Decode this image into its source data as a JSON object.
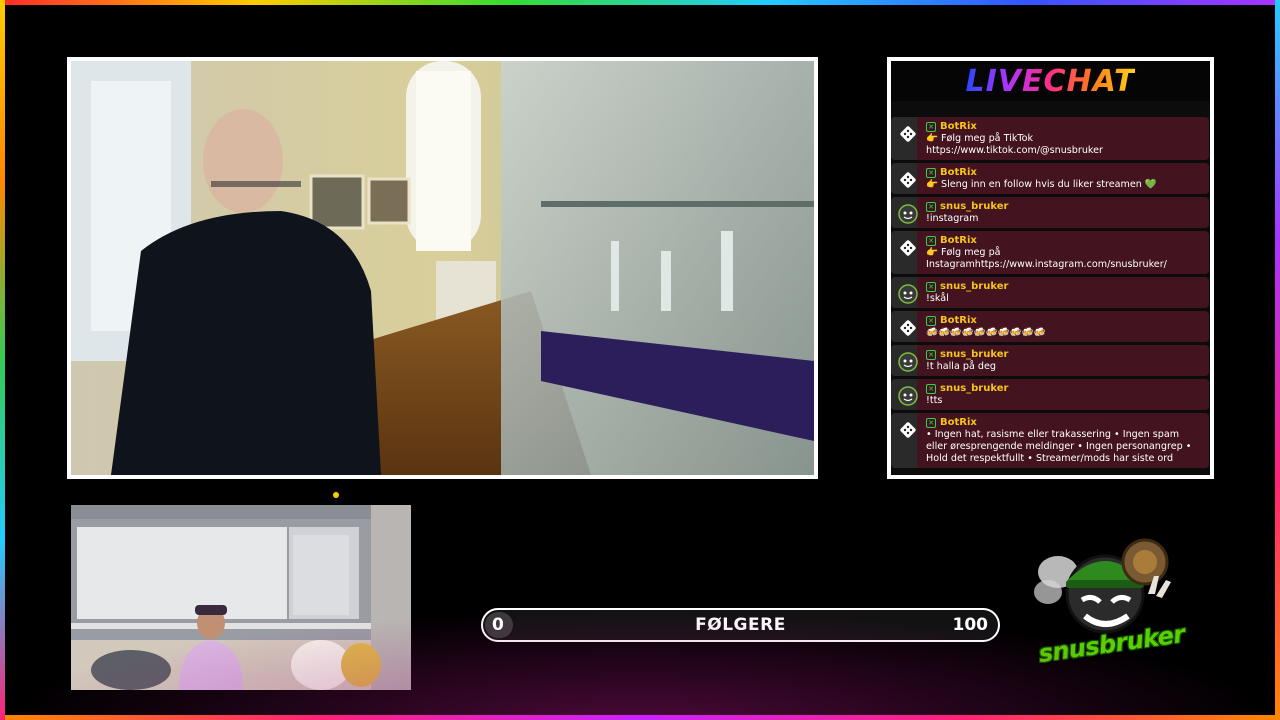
{
  "chat": {
    "title": "LIVECHAT",
    "messages": [
      {
        "user": "BotRix",
        "avatar": "dice-icon",
        "lines": [
          "👉 Følg meg på TikTok",
          "https://www.tiktok.com/@snusbruker"
        ]
      },
      {
        "user": "BotRix",
        "avatar": "dice-icon",
        "lines": [
          "👉 Sleng inn en follow hvis du liker streamen 💚"
        ]
      },
      {
        "user": "snus_bruker",
        "avatar": "snus-avatar",
        "lines": [
          "!instagram"
        ]
      },
      {
        "user": "BotRix",
        "avatar": "dice-icon",
        "lines": [
          "👉 Følg meg på",
          "Instagramhttps://www.instagram.com/snusbruker/"
        ]
      },
      {
        "user": "snus_bruker",
        "avatar": "snus-avatar",
        "lines": [
          "!skål"
        ]
      },
      {
        "user": "BotRix",
        "avatar": "dice-icon",
        "lines": [
          "🍻🍻🍻🍻🍻🍻🍻🍻🍻🍻"
        ]
      },
      {
        "user": "snus_bruker",
        "avatar": "snus-avatar",
        "lines": [
          "!t halla på deg"
        ]
      },
      {
        "user": "snus_bruker",
        "avatar": "snus-avatar",
        "lines": [
          "!tts"
        ]
      },
      {
        "user": "BotRix",
        "avatar": "dice-icon",
        "lines": [
          "• Ingen hat, rasisme eller trakassering • Ingen spam",
          "eller øresprengende meldinger • Ingen personangrep •",
          "Hold det respektfullt • Streamer/mods har siste ord"
        ]
      }
    ]
  },
  "follow_goal": {
    "label": "FØLGERE",
    "current": "0",
    "target": "100",
    "progress": 0
  },
  "logo": {
    "text": "snusbruker"
  },
  "colors": {
    "chat_username": "#f5c518",
    "chat_bg": "#43141f",
    "verified": "#2fd24c",
    "logo_green": "#5ad000"
  }
}
